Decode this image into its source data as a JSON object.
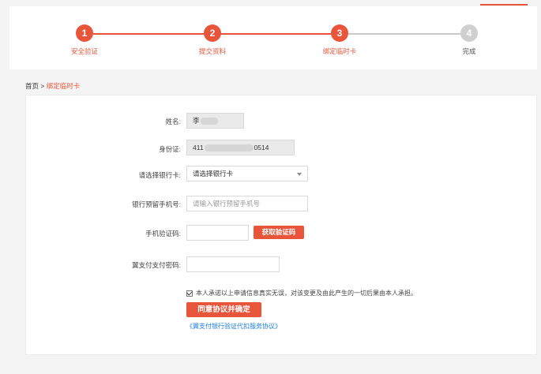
{
  "colors": {
    "accent": "#e8553b",
    "inactive": "#cfcfcf",
    "link": "#1a7dd7"
  },
  "steps": [
    {
      "num": "1",
      "label": "安全验证",
      "state": "active"
    },
    {
      "num": "2",
      "label": "提交资料",
      "state": "active"
    },
    {
      "num": "3",
      "label": "绑定临时卡",
      "state": "active"
    },
    {
      "num": "4",
      "label": "完成",
      "state": "inactive"
    }
  ],
  "breadcrumb": {
    "home": "首页",
    "sep": " > ",
    "current": "绑定临时卡"
  },
  "form": {
    "name": {
      "label": "姓名:",
      "value_prefix": "李"
    },
    "id_card": {
      "label": "身份证:",
      "value_prefix": "411",
      "value_suffix": "0514"
    },
    "bank": {
      "label": "请选择银行卡:",
      "selected": "请选择银行卡"
    },
    "phone": {
      "label": "银行预留手机号:",
      "placeholder": "请输入银行预留手机号"
    },
    "sms": {
      "label": "手机验证码:",
      "button": "获取验证码"
    },
    "pay_password": {
      "label": "翼支付支付密码:"
    }
  },
  "agreement": {
    "text": "本人承诺以上申请信息真实无误，对该变更及由此产生的一切后果由本人承担。",
    "checked": true,
    "submit": "同意协议并确定",
    "link": "《翼支付银行验证代扣服务协议》"
  }
}
